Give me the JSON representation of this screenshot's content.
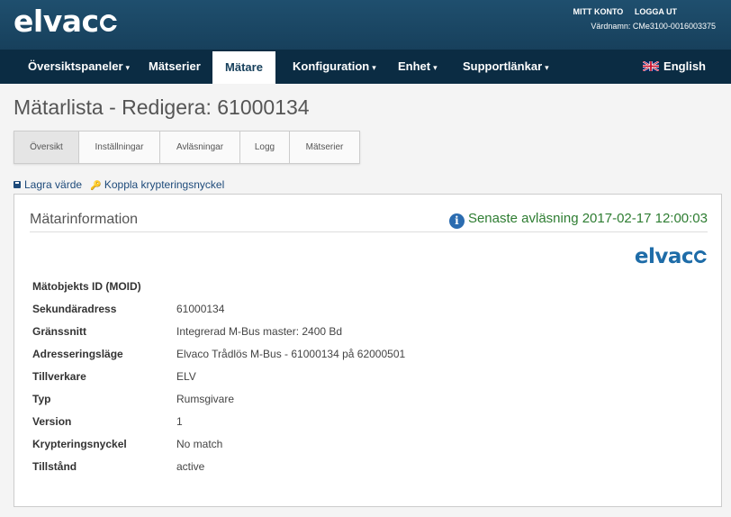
{
  "header": {
    "logo_text": "elvac",
    "links": [
      "MITT KONTO",
      "LOGGA UT"
    ],
    "hostname": "Värdnamn: CMe3100-0016003375"
  },
  "nav": {
    "items": [
      {
        "label": "Översiktspaneler",
        "caret": "▾",
        "active": false
      },
      {
        "label": "Mätserier",
        "caret": "",
        "active": false
      },
      {
        "label": "Mätare",
        "caret": "",
        "active": true
      },
      {
        "label": "Konfiguration",
        "caret": "▾",
        "active": false
      },
      {
        "label": "Enhet",
        "caret": "▾",
        "active": false
      },
      {
        "label": "Supportlänkar",
        "caret": "▾",
        "active": false
      }
    ],
    "language": "English",
    "language_icon": "uk-flag-icon"
  },
  "page": {
    "title": "Mätarlista - Redigera: 61000134"
  },
  "tabs": [
    {
      "label": "Översikt",
      "active": true
    },
    {
      "label": "Inställningar",
      "active": false
    },
    {
      "label": "Avläsningar",
      "active": false
    },
    {
      "label": "Logg",
      "active": false
    },
    {
      "label": "Mätserier",
      "active": false
    }
  ],
  "actions": {
    "save_value": "Lagra värde",
    "link_key": "Koppla krypteringsnyckel"
  },
  "panel": {
    "title": "Mätarinformation",
    "last_reading": "Senaste avläsning 2017-02-17 12:00:03",
    "brand_text": "elvac",
    "rows": [
      {
        "label": "Mätobjekts ID (MOID)",
        "value": ""
      },
      {
        "label": "Sekundäradress",
        "value": "61000134"
      },
      {
        "label": "Gränssnitt",
        "value": "Integrerad M-Bus master: 2400 Bd"
      },
      {
        "label": "Adresseringsläge",
        "value": "Elvaco Trådlös M-Bus - 61000134 på 62000501"
      },
      {
        "label": "Tillverkare",
        "value": "ELV"
      },
      {
        "label": "Typ",
        "value": "Rumsgivare"
      },
      {
        "label": "Version",
        "value": "1"
      },
      {
        "label": "Krypteringsnyckel",
        "value": "No match"
      },
      {
        "label": "Tillstånd",
        "value": "active"
      }
    ]
  },
  "colors": {
    "header_bg": "#1b4866",
    "nav_bg": "#0b2c43",
    "accent_green": "#2e7d32",
    "link_blue": "#1d4a7a"
  }
}
